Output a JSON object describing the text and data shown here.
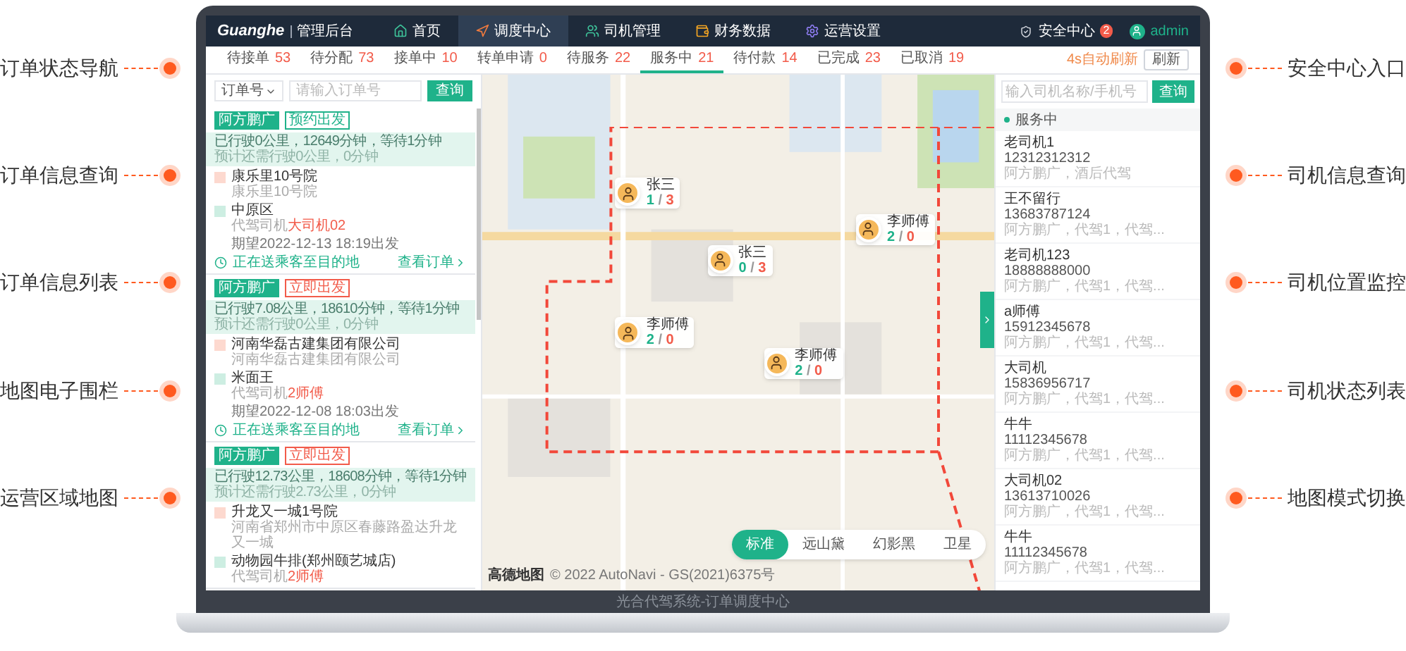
{
  "callouts_left": [
    {
      "label": "订单状态导航"
    },
    {
      "label": "订单信息查询"
    },
    {
      "label": "订单信息列表"
    },
    {
      "label": "地图电子围栏"
    },
    {
      "label": "运营区域地图"
    }
  ],
  "callouts_right": [
    {
      "label": "安全中心入口"
    },
    {
      "label": "司机信息查询"
    },
    {
      "label": "司机位置监控"
    },
    {
      "label": "司机状态列表"
    },
    {
      "label": "地图模式切换"
    }
  ],
  "header": {
    "logo": "Guanghe",
    "logo_subtitle": "管理后台",
    "nav": [
      {
        "label": "首页",
        "kind": "home",
        "selected": false
      },
      {
        "label": "调度中心",
        "kind": "dispatch",
        "selected": true
      },
      {
        "label": "司机管理",
        "kind": "drivers",
        "selected": false
      },
      {
        "label": "财务数据",
        "kind": "finance",
        "selected": false
      },
      {
        "label": "运营设置",
        "kind": "settings",
        "selected": false
      }
    ],
    "security": {
      "label": "安全中心",
      "badge": "2"
    },
    "user": "admin"
  },
  "status_tabs": [
    {
      "label": "待接单",
      "count": "53",
      "selected": false
    },
    {
      "label": "待分配",
      "count": "73",
      "selected": false
    },
    {
      "label": "接单中",
      "count": "10",
      "selected": false
    },
    {
      "label": "转单申请",
      "count": "0",
      "selected": false
    },
    {
      "label": "待服务",
      "count": "22",
      "selected": false
    },
    {
      "label": "服务中",
      "count": "21",
      "selected": true
    },
    {
      "label": "待付款",
      "count": "14",
      "selected": false
    },
    {
      "label": "已完成",
      "count": "23",
      "selected": false
    },
    {
      "label": "已取消",
      "count": "19",
      "selected": false
    }
  ],
  "auto_refresh": "4s自动刷新",
  "refresh_button": "刷新",
  "order_search": {
    "type_select": "订单号",
    "placeholder": "请输入订单号",
    "button": "查询"
  },
  "orders": [
    {
      "tags": [
        {
          "text": "阿方鹏广",
          "kind": "brand"
        },
        {
          "text": "预约出发",
          "kind": "scheduled"
        }
      ],
      "info": [
        "已行驶0公里，12649分钟，等待1分钟",
        "预计还需行驶0公里，0分钟"
      ],
      "start": {
        "title": "康乐里10号院",
        "sub": "康乐里10号院"
      },
      "end": {
        "title": "中原区",
        "sub": "代驾司机",
        "driver": "大司机02"
      },
      "time": "期望2022-12-13 18:19出发",
      "status": "正在送乘客至目的地",
      "link": "查看订单"
    },
    {
      "tags": [
        {
          "text": "阿方鹏广",
          "kind": "brand"
        },
        {
          "text": "立即出发",
          "kind": "immediate"
        }
      ],
      "info": [
        "已行驶7.08公里，18610分钟，等待1分钟",
        "预计还需行驶0公里，0分钟"
      ],
      "start": {
        "title": "河南华磊古建集团有限公司",
        "sub": "河南华磊古建集团有限公司"
      },
      "end": {
        "title": "米面王",
        "sub": "代驾司机",
        "driver": "2师傅"
      },
      "time": "期望2022-12-08 18:03出发",
      "status": "正在送乘客至目的地",
      "link": "查看订单"
    },
    {
      "tags": [
        {
          "text": "阿方鹏广",
          "kind": "brand"
        },
        {
          "text": "立即出发",
          "kind": "immediate"
        }
      ],
      "info": [
        "已行驶12.73公里，18608分钟，等待1分钟",
        "预计还需行驶2.73公里，0分钟"
      ],
      "start": {
        "title": "升龙又一城1号院",
        "sub": "河南省郑州市中原区春藤路盈达升龙又一城"
      },
      "end": {
        "title": "动物园牛排(郑州颐艺城店)",
        "sub": "代驾司机",
        "driver": "2师傅"
      }
    }
  ],
  "map": {
    "markers": [
      {
        "name": "张三",
        "done": "1",
        "separator": "/",
        "total": "3"
      },
      {
        "name": "张三",
        "done": "0",
        "separator": "/",
        "total": "3"
      },
      {
        "name": "李师傅",
        "done": "2",
        "separator": "/",
        "total": "0"
      },
      {
        "name": "李师傅",
        "done": "2",
        "separator": "/",
        "total": "0"
      },
      {
        "name": "李师傅",
        "done": "2",
        "separator": "/",
        "total": "0"
      }
    ],
    "modes": [
      {
        "label": "标准",
        "selected": true
      },
      {
        "label": "远山黛",
        "selected": false
      },
      {
        "label": "幻影黑",
        "selected": false
      },
      {
        "label": "卫星",
        "selected": false
      }
    ],
    "attribution_logo": "高德地图",
    "attribution": "© 2022 AutoNavi - GS(2021)6375号"
  },
  "driver_search": {
    "placeholder": "输入司机名称/手机号",
    "button": "查询"
  },
  "driver_group": "服务中",
  "drivers": [
    {
      "name": "老司机1",
      "phone": "12312312312",
      "note": "阿方鹏广，酒后代驾"
    },
    {
      "name": "王不留行",
      "phone": "13683787124",
      "note": "阿方鹏广，代驾1，代驾..."
    },
    {
      "name": "老司机123",
      "phone": "18888888000",
      "note": "阿方鹏广，代驾1，代驾..."
    },
    {
      "name": "a师傅",
      "phone": "15912345678",
      "note": "阿方鹏广，代驾1，代驾..."
    },
    {
      "name": "大司机",
      "phone": "15836956717",
      "note": "阿方鹏广，代驾1，代驾..."
    },
    {
      "name": "牛牛",
      "phone": "11112345678",
      "note": "阿方鹏广，代驾1，代驾..."
    },
    {
      "name": "大司机02",
      "phone": "13613710026",
      "note": "阿方鹏广，代驾1，代驾..."
    },
    {
      "name": "牛牛",
      "phone": "11112345678",
      "note": "阿方鹏广，代驾1，代驾..."
    }
  ],
  "caption": "光合代驾系统-订单调度中心"
}
